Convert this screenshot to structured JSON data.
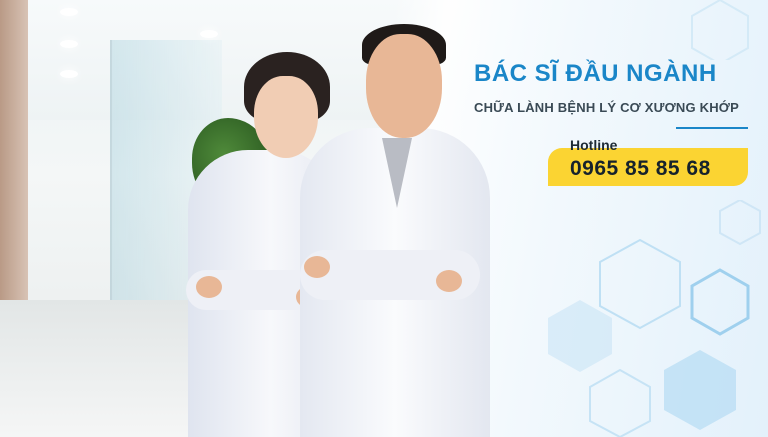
{
  "banner": {
    "title": "BÁC SĨ ĐẦU NGÀNH",
    "subtitle": "CHỮA LÀNH BỆNH LÝ CƠ XƯƠNG KHỚP",
    "hotline_label": "Hotline",
    "hotline_number": "0965 85 85 68"
  },
  "colors": {
    "accent_blue": "#1a86c8",
    "hotline_yellow": "#fbd432",
    "text_dark": "#16222c"
  },
  "icons": [
    "hexagon-decoration",
    "doctor-photo"
  ]
}
